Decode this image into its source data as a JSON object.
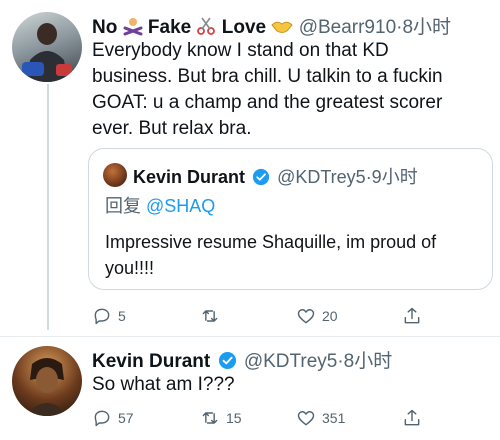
{
  "tweet1": {
    "name_parts": [
      "No",
      "Fake",
      "Love"
    ],
    "handle": "@Bearr910",
    "time": "·8小时",
    "text_lines": [
      "Everybody know I stand on that KD",
      "business. But bra chill. U talkin to a fuckin",
      "GOAT: u a champ and the greatest scorer",
      "ever. But relax bra."
    ],
    "emoji_icons": [
      "man-gesturing-no-icon",
      "scissors-icon",
      "handshake-icon"
    ],
    "quote": {
      "name": "Kevin Durant",
      "handle": "@KDTrey5",
      "time": "·9小时",
      "reply_label": "回复",
      "reply_to": "@SHAQ",
      "text_lines": [
        "Impressive resume Shaquille, im proud of",
        "you!!!!"
      ]
    },
    "actions": {
      "reply_count": "5",
      "retweet_count": "",
      "like_count": "20"
    }
  },
  "tweet2": {
    "name": "Kevin Durant",
    "handle": "@KDTrey5",
    "time": "·8小时",
    "text": "So what am I???",
    "actions": {
      "reply_count": "57",
      "retweet_count": "15",
      "like_count": "351"
    }
  },
  "colors": {
    "text": "#0f1419",
    "secondary": "#536471",
    "verified": "#1d9bf0",
    "link": "#1d9bf0",
    "border": "#cfd9de"
  }
}
